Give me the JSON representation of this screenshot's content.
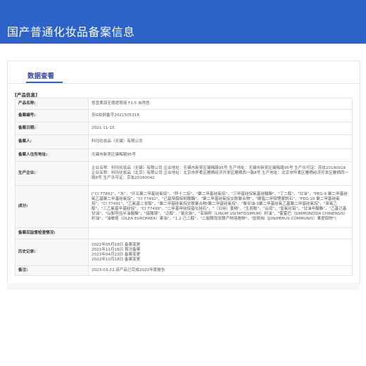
{
  "header": {
    "title": "国产普通化妆品备案信息"
  },
  "tabs": {
    "active": "数据查看"
  },
  "section_title": "[产品信息]",
  "rows": [
    {
      "label": "产品名称:",
      "value": "悠宜柔润无瑕遮瑕液 F1.5 自然色"
    },
    {
      "label": "备案编号:",
      "value": "苏G妆网备字2021505318"
    },
    {
      "label": "备案日期:",
      "value": "2021-11-15"
    },
    {
      "label": "备案人:",
      "value": "科玛化妆品（无锡）有限公司"
    },
    {
      "label": "备案人住所地址:",
      "value": "无锡市新吴区锡梅路95号"
    },
    {
      "label": "生产企业:",
      "value": "企业名称：科玛化妆品（无锡）有限公司 企业地址：无锡市新吴区锡梅路95号 生产地址：无锡市新吴区锡梅路95号 生产许可证：苏妆20180016 企业名称：科玛化妆品（北京）有限公司 企业地址：北京市怀柔区雁栖经济开发区雁栖西一路8号 生产地址：北京市怀柔区雁栖经济开发区雁栖西一路8号 生产许可证：京妆20160042"
    },
    {
      "label": "成分:",
      "value": "[\"CI 77891\"，\"水\"，\"环五聚二甲基硅氧烷\"，\"异十二烷\"，\"聚二甲基硅氧烷\"，\"三甲基硅烷氧基硅酸酯\"，\"丁二醇\"，\"甘油\"，\"PEG-9 聚二甲基硅氧乙基聚二甲基硅氧烷\"，\"CI 77492\"，\"已基癸醇棕榈酸酯\"，\"聚二甲基硅氧烷交联聚合物\"，\"硬脂二甲铵锂蒙脱石\"，\"PEG-10 聚二甲基硅氧烷\"，\"CI 77491\"，\"乙氧基二甘醇\"，\"聚二甲基硅氧烷交联聚合物/聚二甲基硅氧烷\"，\"聚甘油-3聚二甲基硅氧乙基聚二甲基硅氧烷\"，\"苯氧乙醇\"，\"三乙氧基辛基硅烷\"，\"CI 77499\"，\"二甲基甲硅烷基化硅石\"，\"（日用）香精\"，\"生育酚\"，\"云母\"，\"氢氧化铝\"，\"甘油辛酸酯\"，\"乙基己基甘油\"，\"山梨坦倍半油酸酯\"，\"硫酸镁\"，\"泛醇\"，\"氯化钠\"，\"亚麻籽（LINUM USITATISSIMUM）籽油\"，\"霍霍巴（SIMMONDSIA CHINENSIS）籽油\"，\"油橄榄（OLEA EUROPAEA）果油\"，\"1,2-己二醇\"，\"二裂酵母发酵产物溶胞物\"，\"欧刺柏（JUNIPERUS COMMUNIS）果提取物\"]"
    },
    {
      "label": "备案后监督检查情况:",
      "value": ""
    },
    {
      "label": "历史记录:",
      "value": "",
      "history": [
        "2022年05月18日 备案变更",
        "2021年11月16日 首次备案",
        "2023年04月23日 备案变更",
        "2022年10月18日 备案变更"
      ]
    },
    {
      "label": "备注:",
      "value": "2023-03-22,该产品已完成2022年度报告"
    }
  ]
}
